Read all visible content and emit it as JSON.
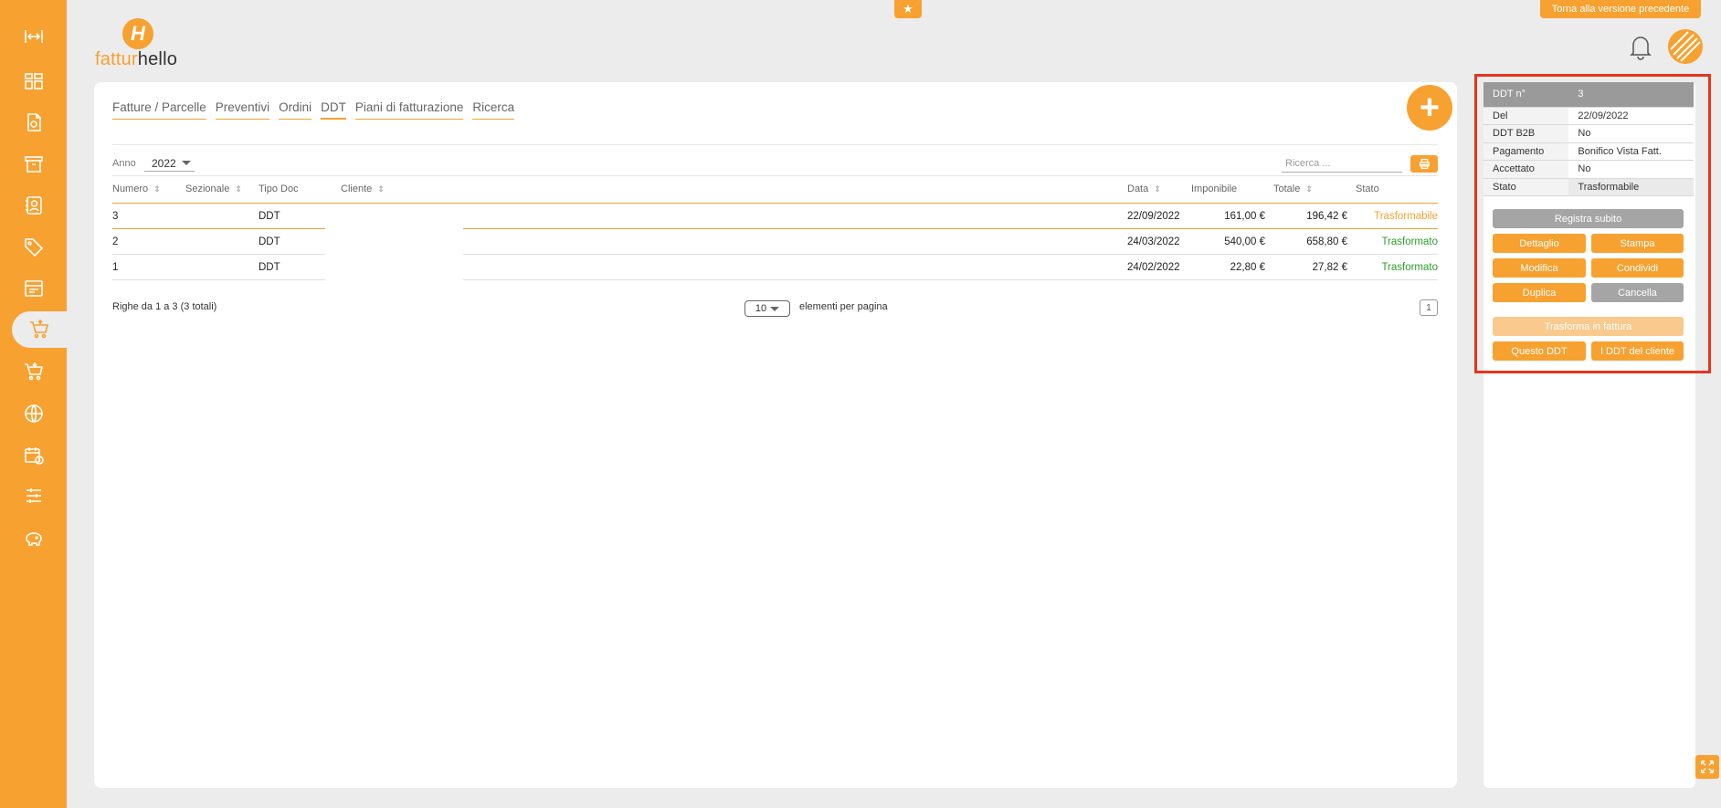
{
  "top": {
    "back_label": "Torna alla versione precedente",
    "logo_mark": "H",
    "logo_part1": "fattur",
    "logo_part2": "hello"
  },
  "tabs": [
    "Fatture / Parcelle",
    "Preventivi",
    "Ordini",
    "DDT",
    "Piani di fatturazione",
    "Ricerca"
  ],
  "active_tab": "DDT",
  "filters": {
    "year_label": "Anno",
    "year_value": "2022",
    "search_placeholder": "Ricerca ..."
  },
  "table": {
    "headers": {
      "numero": "Numero",
      "sezionale": "Sezionale",
      "tipo": "Tipo Doc",
      "cliente": "Cliente",
      "data": "Data",
      "imponibile": "Imponibile",
      "totale": "Totale",
      "stato": "Stato"
    },
    "rows": [
      {
        "numero": "3",
        "tipo": "DDT",
        "data": "22/09/2022",
        "imponibile": "161,00 €",
        "totale": "196,42 €",
        "stato": "Trasformabile",
        "stato_color": "#f7a130"
      },
      {
        "numero": "2",
        "tipo": "DDT",
        "data": "24/03/2022",
        "imponibile": "540,00 €",
        "totale": "658,80 €",
        "stato": "Trasformato",
        "stato_color": "#2e9d2e"
      },
      {
        "numero": "1",
        "tipo": "DDT",
        "data": "24/02/2022",
        "imponibile": "22,80 €",
        "totale": "27,82 €",
        "stato": "Trasformato",
        "stato_color": "#2e9d2e"
      }
    ]
  },
  "pagination": {
    "summary": "Righe da 1 a 3 (3 totali)",
    "page_size": "10",
    "per_page_label": "elementi per pagina",
    "current_page": "1"
  },
  "detail": {
    "rows": [
      {
        "label": "DDT n°",
        "value": "3"
      },
      {
        "label": "Del",
        "value": "22/09/2022"
      },
      {
        "label": "DDT B2B",
        "value": "No"
      },
      {
        "label": "Pagamento",
        "value": "Bonifico Vista Fatt."
      },
      {
        "label": "Accettato",
        "value": "No"
      },
      {
        "label": "Stato",
        "value": "Trasformabile"
      }
    ],
    "buttons": {
      "registra": "Registra subito",
      "dettaglio": "Dettaglio",
      "stampa": "Stampa",
      "modifica": "Modifica",
      "condividi": "Condividi",
      "duplica": "Duplica",
      "cancella": "Cancella",
      "trasforma": "Trasforma in fattura",
      "questo": "Questo DDT",
      "cliente": "I DDT del cliente"
    }
  },
  "colors": {
    "accent": "#f7a130",
    "success": "#2e9d2e",
    "highlight": "#e8331c"
  }
}
